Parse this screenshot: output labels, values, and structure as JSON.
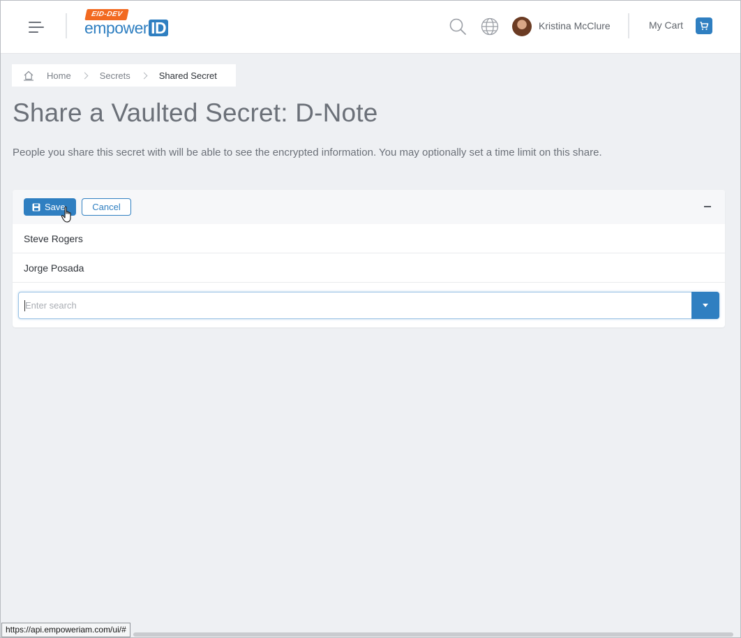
{
  "header": {
    "logo": {
      "badge": "EID-DEV",
      "text_main": "empower",
      "text_id": "ID"
    },
    "user_name": "Kristina McClure",
    "cart_label": "My Cart",
    "icons": [
      "menu-icon",
      "search-icon",
      "globe-icon",
      "cart-icon"
    ]
  },
  "breadcrumb": {
    "items": [
      {
        "label": "Home"
      },
      {
        "label": "Secrets"
      },
      {
        "label": "Shared Secret"
      }
    ]
  },
  "page": {
    "title": "Share a Vaulted Secret: D-Note",
    "description": "People you share this secret with will be able to see the encrypted information. You may optionally set a time limit on this share."
  },
  "card": {
    "save_label": "Save",
    "cancel_label": "Cancel",
    "people": [
      {
        "name": "Steve Rogers"
      },
      {
        "name": "Jorge Posada"
      }
    ],
    "search": {
      "placeholder": "Enter search",
      "value": ""
    }
  },
  "status_bar": {
    "url": "https://api.empoweriam.com/ui/#"
  },
  "colors": {
    "accent": "#2f7fc1",
    "badge": "#f26a21",
    "background": "#eef0f3"
  }
}
